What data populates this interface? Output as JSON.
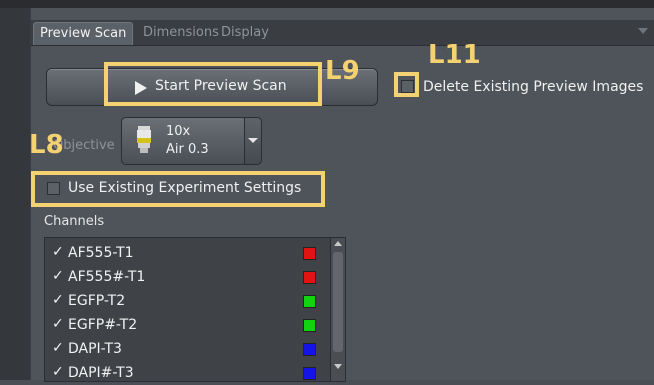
{
  "tabs": [
    {
      "label": "Preview Scan",
      "active": true
    },
    {
      "label": "Dimensions",
      "active": false
    },
    {
      "label": "Display",
      "active": false
    }
  ],
  "start_button": {
    "label": "Start Preview Scan",
    "icon": "play-icon"
  },
  "delete_existing": {
    "label": "Delete Existing Preview Images",
    "checked": false
  },
  "objective": {
    "label": "Objective",
    "name": "10x",
    "na": "Air 0.3",
    "icon": "objective-lens-icon"
  },
  "use_existing": {
    "label": "Use Existing Experiment Settings",
    "checked": false
  },
  "channels": {
    "label": "Channels",
    "items": [
      {
        "name": "AF555-T1",
        "checked": true,
        "color": "#e11414"
      },
      {
        "name": "AF555#-T1",
        "checked": true,
        "color": "#e11414"
      },
      {
        "name": "EGFP-T2",
        "checked": true,
        "color": "#11d411"
      },
      {
        "name": "EGFP#-T2",
        "checked": true,
        "color": "#11d411"
      },
      {
        "name": "DAPI-T3",
        "checked": true,
        "color": "#1414e6"
      },
      {
        "name": "DAPI#-T3",
        "checked": true,
        "color": "#1414e6"
      }
    ]
  },
  "annotations": [
    {
      "label": "L9"
    },
    {
      "label": "L11"
    },
    {
      "label": "L8"
    }
  ],
  "accent": "#f4d171"
}
